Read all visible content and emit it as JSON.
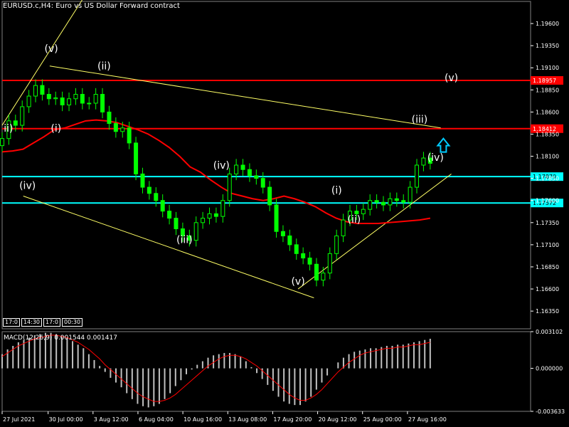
{
  "header": {
    "title": "EURUSD.c,H4:  Euro vs US Dollar Forward contract",
    "timeframes": [
      "17:0",
      "14:30",
      "17:0",
      "00:30"
    ]
  },
  "macd": {
    "title": "MACD(12,26,9) 0.001544 0.001417",
    "ticks": [
      "0.003102",
      "0.000000",
      "-0.003633"
    ]
  },
  "colors": {
    "background": "#000000",
    "bull_candle": "#00ff00",
    "ma_line": "#ff0000",
    "resistance_line": "#ff0000",
    "support_line": "#00ffff",
    "trend_line": "#ffff66",
    "macd_hist": "#c0c0c0",
    "macd_signal": "#ff0000",
    "arrow": "#00ccff"
  },
  "chart_data": {
    "type": "line",
    "symbol": "EURUSD.c",
    "timeframe": "H4",
    "ylim": [
      1.1615,
      1.1985
    ],
    "y_ticks": [
      "1.19600",
      "1.19350",
      "1.19100",
      "1.18850",
      "1.18600",
      "1.18350",
      "1.18100",
      "1.17850",
      "1.17600",
      "1.17350",
      "1.17100",
      "1.16850",
      "1.16600",
      "1.16350"
    ],
    "x_ticks": [
      "27 Jul 2021",
      "30 Jul 00:00",
      "3 Aug 12:00",
      "6 Aug 04:00",
      "10 Aug 16:00",
      "13 Aug 08:00",
      "17 Aug 20:00",
      "20 Aug 12:00",
      "25 Aug 00:00",
      "27 Aug 16:00"
    ],
    "close_series": [
      1.183,
      1.185,
      1.1845,
      1.1866,
      1.1878,
      1.189,
      1.188,
      1.1875,
      1.1876,
      1.1868,
      1.1875,
      1.188,
      1.187,
      1.187,
      1.188,
      1.186,
      1.1847,
      1.1838,
      1.1842,
      1.1825,
      1.179,
      1.1775,
      1.1768,
      1.176,
      1.1748,
      1.174,
      1.1728,
      1.172,
      1.1715,
      1.1735,
      1.174,
      1.1745,
      1.1742,
      1.176,
      1.179,
      1.18,
      1.1795,
      1.1788,
      1.1785,
      1.1775,
      1.1755,
      1.1725,
      1.172,
      1.171,
      1.17,
      1.1695,
      1.1688,
      1.167,
      1.1678,
      1.17,
      1.172,
      1.1738,
      1.1748,
      1.1745,
      1.175,
      1.176,
      1.1758,
      1.1755,
      1.1762,
      1.176,
      1.1758,
      1.1775,
      1.18,
      1.1808,
      1.1802
    ],
    "moving_average": [
      1.1815,
      1.1816,
      1.1818,
      1.1825,
      1.1832,
      1.184,
      1.1842,
      1.1846,
      1.185,
      1.1851,
      1.185,
      1.1848,
      1.1844,
      1.184,
      1.1835,
      1.1828,
      1.182,
      1.181,
      1.1798,
      1.1792,
      1.1783,
      1.1775,
      1.1768,
      1.1765,
      1.1762,
      1.176,
      1.1762,
      1.1765,
      1.1762,
      1.1758,
      1.1753,
      1.1746,
      1.174,
      1.1736,
      1.1734,
      1.1734,
      1.1734,
      1.1735,
      1.1736,
      1.1737,
      1.1738,
      1.174
    ],
    "horizontal_levels": [
      {
        "value": 1.18957,
        "label": "1.18957",
        "kind": "resistance"
      },
      {
        "value": 1.18412,
        "label": "1.18412",
        "kind": "resistance"
      },
      {
        "value": 1.1787,
        "label": "1.17870",
        "kind": "support"
      },
      {
        "value": 1.17572,
        "label": "1.17572",
        "kind": "support"
      }
    ],
    "trend_lines": [
      {
        "from": [
          0.0,
          1.1845
        ],
        "to": [
          0.155,
          1.199
        ]
      },
      {
        "from": [
          0.09,
          1.1912
        ],
        "to": [
          0.83,
          1.1842
        ]
      },
      {
        "from": [
          0.04,
          1.1765
        ],
        "to": [
          0.59,
          1.165
        ]
      },
      {
        "from": [
          0.56,
          1.166
        ],
        "to": [
          0.85,
          1.179
        ]
      }
    ],
    "wave_labels": [
      {
        "text": "ii)",
        "t": 0.012,
        "price": 1.1838
      },
      {
        "text": "(v)",
        "t": 0.093,
        "price": 1.1928
      },
      {
        "text": "(ii)",
        "t": 0.193,
        "price": 1.1908
      },
      {
        "text": "(i)",
        "t": 0.102,
        "price": 1.1838
      },
      {
        "text": "(iv)",
        "t": 0.048,
        "price": 1.1773
      },
      {
        "text": "(iv)",
        "t": 0.415,
        "price": 1.1796
      },
      {
        "text": "(iii)",
        "t": 0.345,
        "price": 1.1712
      },
      {
        "text": "(i)",
        "t": 0.633,
        "price": 1.1768
      },
      {
        "text": "(ii)",
        "t": 0.666,
        "price": 1.1735
      },
      {
        "text": "(v)",
        "t": 0.56,
        "price": 1.1665
      },
      {
        "text": "(iii)",
        "t": 0.79,
        "price": 1.1848
      },
      {
        "text": "(iv)",
        "t": 0.82,
        "price": 1.1805
      },
      {
        "text": "(v)",
        "t": 0.85,
        "price": 1.1895
      }
    ],
    "macd_hist": [
      1.2,
      1.6,
      1.9,
      2.2,
      2.4,
      2.6,
      2.8,
      2.9,
      3.0,
      3.0,
      2.9,
      2.7,
      2.6,
      2.3,
      2.0,
      1.7,
      1.2,
      0.7,
      0.2,
      -0.3,
      -0.8,
      -1.2,
      -1.6,
      -2.1,
      -2.6,
      -3.0,
      -3.2,
      -3.3,
      -3.2,
      -3.0,
      -2.6,
      -2.1,
      -1.5,
      -1.0,
      -0.5,
      -0.1,
      0.3,
      0.6,
      0.9,
      1.1,
      1.2,
      1.3,
      1.3,
      1.2,
      1.0,
      0.6,
      0.1,
      -0.4,
      -0.9,
      -1.4,
      -1.9,
      -2.4,
      -2.8,
      -3.0,
      -3.1,
      -3.1,
      -2.8,
      -2.4,
      -1.8,
      -1.2,
      -0.6,
      0.0,
      0.5,
      0.9,
      1.2,
      1.4,
      1.5,
      1.6,
      1.7,
      1.7,
      1.8,
      1.9,
      1.9,
      2.0,
      2.0,
      2.1,
      2.2,
      2.3,
      2.4,
      2.5
    ],
    "macd_signal": [
      1.0,
      1.3,
      1.6,
      1.9,
      2.1,
      2.3,
      2.5,
      2.6,
      2.7,
      2.8,
      2.8,
      2.7,
      2.6,
      2.4,
      2.2,
      1.9,
      1.6,
      1.2,
      0.8,
      0.3,
      -0.1,
      -0.5,
      -0.9,
      -1.3,
      -1.7,
      -2.1,
      -2.4,
      -2.6,
      -2.8,
      -2.8,
      -2.7,
      -2.5,
      -2.2,
      -1.8,
      -1.4,
      -1.0,
      -0.6,
      -0.2,
      0.2,
      0.5,
      0.8,
      1.0,
      1.1,
      1.1,
      1.0,
      0.8,
      0.5,
      0.2,
      -0.2,
      -0.6,
      -1.0,
      -1.4,
      -1.8,
      -2.2,
      -2.5,
      -2.7,
      -2.7,
      -2.5,
      -2.2,
      -1.8,
      -1.3,
      -0.8,
      -0.3,
      0.1,
      0.5,
      0.8,
      1.1,
      1.3,
      1.4,
      1.5,
      1.6,
      1.7,
      1.7,
      1.8,
      1.8,
      1.9,
      2.0,
      2.0,
      2.1,
      2.2
    ]
  }
}
